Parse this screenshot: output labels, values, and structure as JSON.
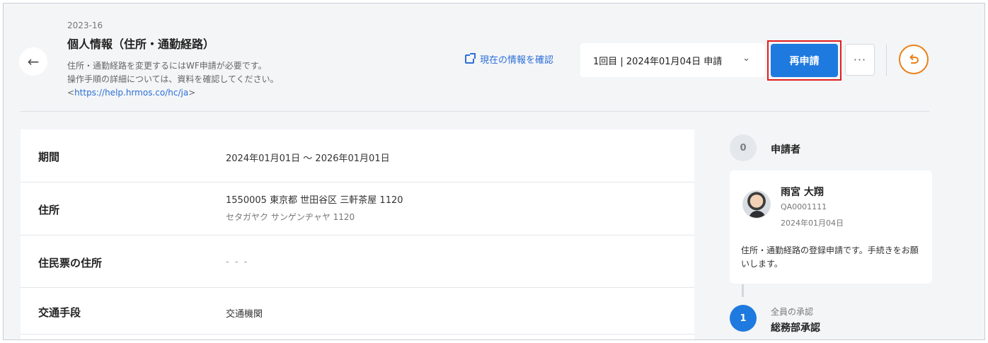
{
  "header": {
    "doc_no": "2023-16",
    "title": "個人情報（住所・通勤経路）",
    "desc_line1": "住所・通勤経路を変更するにはWF申請が必要です。",
    "desc_line2": "操作手順の詳細については、資料を確認してください。",
    "link_prefix": "<",
    "link_text": "https://help.hrmos.co/hc/ja",
    "link_suffix": ">",
    "confirm_link": "現在の情報を確認",
    "round_select": "1回目 | 2024年01月04日 申請",
    "reapply_button": "再申請",
    "more_button": "···"
  },
  "details": [
    {
      "label": "期間",
      "value": "2024年01月01日 〜 2026年01月01日"
    },
    {
      "label": "住所",
      "value": "1550005 東京都 世田谷区 三軒茶屋 1120",
      "sub": "セタガヤク サンゲンヂャヤ 1120"
    },
    {
      "label": "住民票の住所",
      "value": "- - -"
    },
    {
      "label": "交通手段",
      "value": "交通機関"
    }
  ],
  "sidebar": {
    "step0_number": "0",
    "step0_label": "申請者",
    "applicant": {
      "name": "雨宮 大翔",
      "id": "QA0001111",
      "date": "2024年01月04日",
      "comment": "住所・通勤経路の登録申請です。手続きをお願いします。"
    },
    "step1_number": "1",
    "step1_type": "全員の承認",
    "step1_name": "総務部承認"
  },
  "colors": {
    "accent": "#1f7ae0",
    "highlight": "#e11d1d",
    "undo": "#e8821a"
  },
  "icons": [
    "arrow-left-icon",
    "external-link-icon",
    "chevron-down-icon",
    "more-icon",
    "undo-icon",
    "avatar"
  ]
}
